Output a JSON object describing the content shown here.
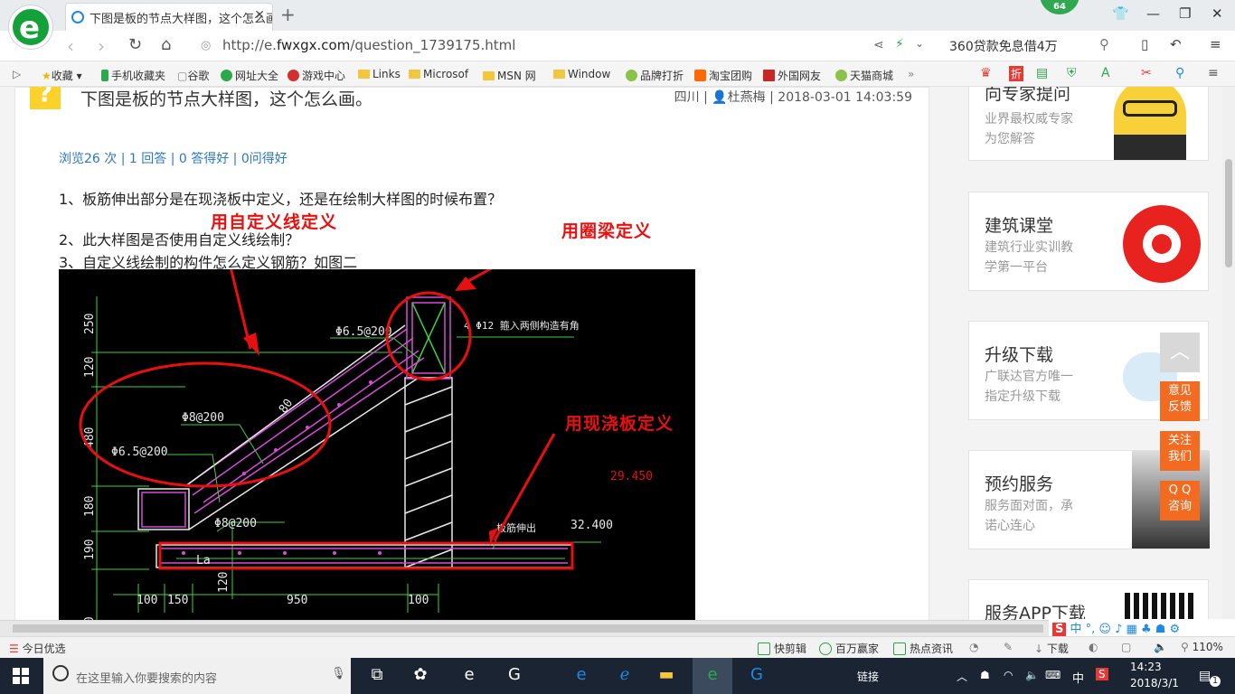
{
  "browser": {
    "tab_title": "下图是板的节点大样图，这个怎么画",
    "notification_count": "64",
    "url_prefix": "http://e.",
    "url_domain": "fwxgx.com",
    "url_path": "/question_1739175.html",
    "search_box_text": "360贷款免息借4万"
  },
  "bookmarks": [
    "收藏",
    "手机收藏夹",
    "谷歌",
    "网址大全",
    "游戏中心",
    "Links",
    "Microsof",
    "MSN 网",
    "Window",
    "品牌打折",
    "淘宝团购",
    "外国网友",
    "天猫商城"
  ],
  "question": {
    "title": "下图是板的节点大样图，这个怎么画。",
    "region": "四川",
    "author": "杜燕梅",
    "datetime": "2018-03-01 14:03:59",
    "separator": "|",
    "stats": "浏览26 次 | 1 回答 | 0 答得好 | 0问得好",
    "lines": [
      "1、板筋伸出部分是在现浇板中定义，还是在绘制大样图的时候布置？",
      "2、此大样图是否使用自定义线绘制？",
      "3、自定义线绘制的构件怎么定义钢筋？如图二"
    ]
  },
  "annotations": {
    "custom_line": "用自定义线定义",
    "ring_beam": "用圈梁定义",
    "cast_slab": "用现浇板定义"
  },
  "cad_labels": {
    "d250": "250",
    "d120": "120",
    "d480": "480",
    "d180": "180",
    "d190": "190",
    "d120b": "120",
    "d80": "80",
    "r1": "Φ6.5@200",
    "r2": "Φ8@200",
    "r3": "Φ6.5@200",
    "r4": "Φ8@200",
    "beam_note": "4 Φ12 箍入两侧构造有角",
    "elev1": "29.450",
    "elev2": "32.400",
    "la": "La",
    "slab_note": "板筋伸出",
    "b100a": "100",
    "b150": "150",
    "b950": "950",
    "b100b": "100"
  },
  "sidebar": [
    {
      "title": "向专家提问",
      "sub1": "业界最权威专家",
      "sub2": "为您解答"
    },
    {
      "title": "建筑课堂",
      "sub1": "建筑行业实训教",
      "sub2": "学第一平台"
    },
    {
      "title": "升级下载",
      "sub1": "广联达官方唯一",
      "sub2": "指定升级下载"
    },
    {
      "title": "预约服务",
      "sub1": "服务面对面，承",
      "sub2": "诺心连心"
    },
    {
      "title": "服务APP下载",
      "sub1": "",
      "sub2": ""
    }
  ],
  "float_buttons": {
    "top": "︿",
    "feedback": "意见\n反馈",
    "follow": "关注\n我们",
    "qq": "Q Q\n咨询"
  },
  "statusbar": {
    "today": "今日优选",
    "items": [
      "快剪辑",
      "百万赢家",
      "热点资讯"
    ],
    "download": "下载",
    "zoom": "110%"
  },
  "taskbar": {
    "search_placeholder": "在这里输入你要搜索的内容",
    "link_label": "链接",
    "ime": "中",
    "time": "14:23",
    "date": "2018/3/1",
    "notif": "1"
  },
  "colors": {
    "accent": "#2b78c5",
    "annotation": "#e8100f",
    "brand": "#15a13a",
    "orange": "#f26b21"
  }
}
